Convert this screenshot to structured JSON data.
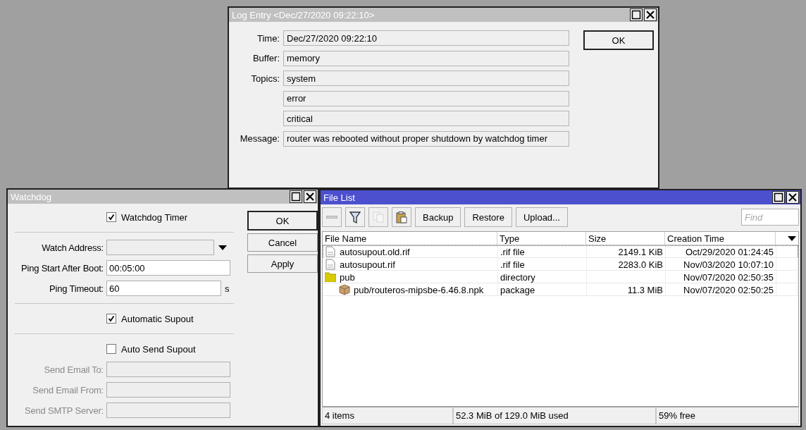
{
  "log_entry": {
    "title": "Log Entry <Dec/27/2020 09:22:10>",
    "active": false,
    "fields": [
      {
        "label": "Time:",
        "value": "Dec/27/2020 09:22:10"
      },
      {
        "label": "Buffer:",
        "value": "memory"
      },
      {
        "label": "Topics:",
        "value": "system"
      },
      {
        "value": "error"
      },
      {
        "value": "critical"
      },
      {
        "label": "Message:",
        "value": "router was rebooted without proper shutdown by watchdog timer"
      }
    ],
    "buttons": [
      "OK"
    ]
  },
  "watchdog": {
    "title": "Watchdog",
    "active": false,
    "sections": [
      [
        {
          "kind": "checkbox",
          "label": "Watchdog Timer",
          "checked": true
        }
      ],
      [
        {
          "kind": "combo",
          "label": "Watch Address:",
          "disabled": false
        },
        {
          "kind": "field",
          "label": "Ping Start After Boot:",
          "value": "00:05:00",
          "disabled": false
        },
        {
          "kind": "field",
          "label": "Ping Timeout:",
          "value": "60",
          "unit": "s",
          "disabled": false
        }
      ],
      [
        {
          "kind": "checkbox",
          "label": "Automatic Supout",
          "checked": true
        }
      ],
      [
        {
          "kind": "checkbox",
          "label": "Auto Send Supout",
          "checked": false
        },
        {
          "kind": "field",
          "label": "Send Email To:",
          "disabled": true
        },
        {
          "kind": "field",
          "label": "Send Email From:",
          "disabled": true
        },
        {
          "kind": "field",
          "label": "Send SMTP Server:",
          "disabled": true
        }
      ]
    ],
    "buttons": [
      "OK",
      "Cancel",
      "Apply"
    ]
  },
  "file_list": {
    "title": "File List",
    "active": true,
    "toolbar": [
      {
        "kind": "remove",
        "disabled": false
      },
      {
        "kind": "filter",
        "disabled": false
      },
      {
        "kind": "copy",
        "disabled": true
      },
      {
        "kind": "paste",
        "disabled": false
      }
    ],
    "buttons": [
      "Backup",
      "Restore",
      "Upload..."
    ],
    "find": {
      "placeholder": "Find"
    },
    "columns": [
      "File Name",
      "Type",
      "Size",
      "Creation Time"
    ],
    "rows": [
      {
        "kind": "file",
        "name": "autosupout.old.rif",
        "type": ".rif file",
        "size": "2149.1 KiB",
        "created": "Oct/29/2020 01:24:45",
        "selected": true
      },
      {
        "kind": "file",
        "name": "autosupout.rif",
        "type": ".rif file",
        "size": "2283.0 KiB",
        "created": "Nov/03/2020 10:07:10",
        "selected": false
      },
      {
        "kind": "directory",
        "name": "pub",
        "type": "directory",
        "created": "Nov/07/2020 02:50:35",
        "selected": false,
        "children": [
          {
            "kind": "package",
            "name": "pub/routeros-mipsbe-6.46.8.npk",
            "type": "package",
            "size": "11.3 MiB",
            "created": "Nov/07/2020 02:50:25",
            "selected": false
          }
        ]
      }
    ],
    "status_bar": [
      "4 items",
      "52.3 MiB of 129.0 MiB used",
      "59% free"
    ]
  }
}
